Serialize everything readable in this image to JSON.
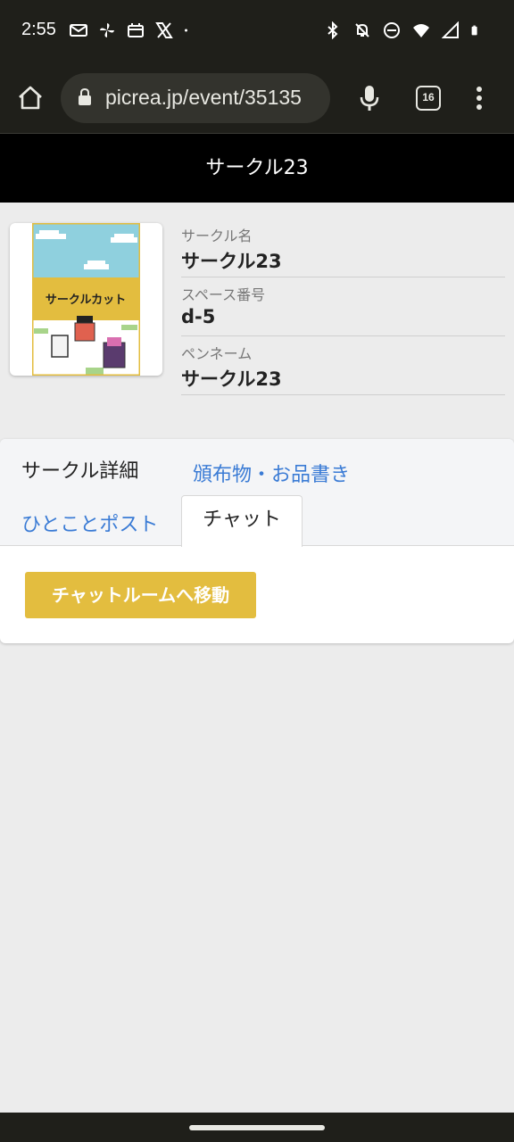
{
  "status_bar": {
    "time": "2:55",
    "left_icons": [
      "gmail-icon",
      "pinwheel-app-icon",
      "calendar-app-icon",
      "x-app-icon",
      "dot-icon"
    ],
    "right_icons": [
      "bluetooth-icon",
      "bell-off-icon",
      "do-not-disturb-icon",
      "wifi-icon",
      "signal-icon",
      "battery-icon"
    ]
  },
  "browser": {
    "url": "picrea.jp/event/35135",
    "tab_count": "16"
  },
  "page": {
    "title": "サークル23"
  },
  "circle": {
    "thumbnail_caption": "サークルカット",
    "fields": [
      {
        "label": "サークル名",
        "value": "サークル23"
      },
      {
        "label": "スペース番号",
        "value": "d-5"
      },
      {
        "label": "ペンネーム",
        "value": "サークル23"
      }
    ]
  },
  "tabs": {
    "details": "サークル詳細",
    "goods": "頒布物・お品書き",
    "posts": "ひとことポスト",
    "chat": "チャット"
  },
  "chat_panel": {
    "button_label": "チャットルームへ移動"
  },
  "colors": {
    "accent_button": "#e3bd3f",
    "link": "#3a7bd5",
    "header_bg": "#000000",
    "page_bg": "#ececec"
  }
}
